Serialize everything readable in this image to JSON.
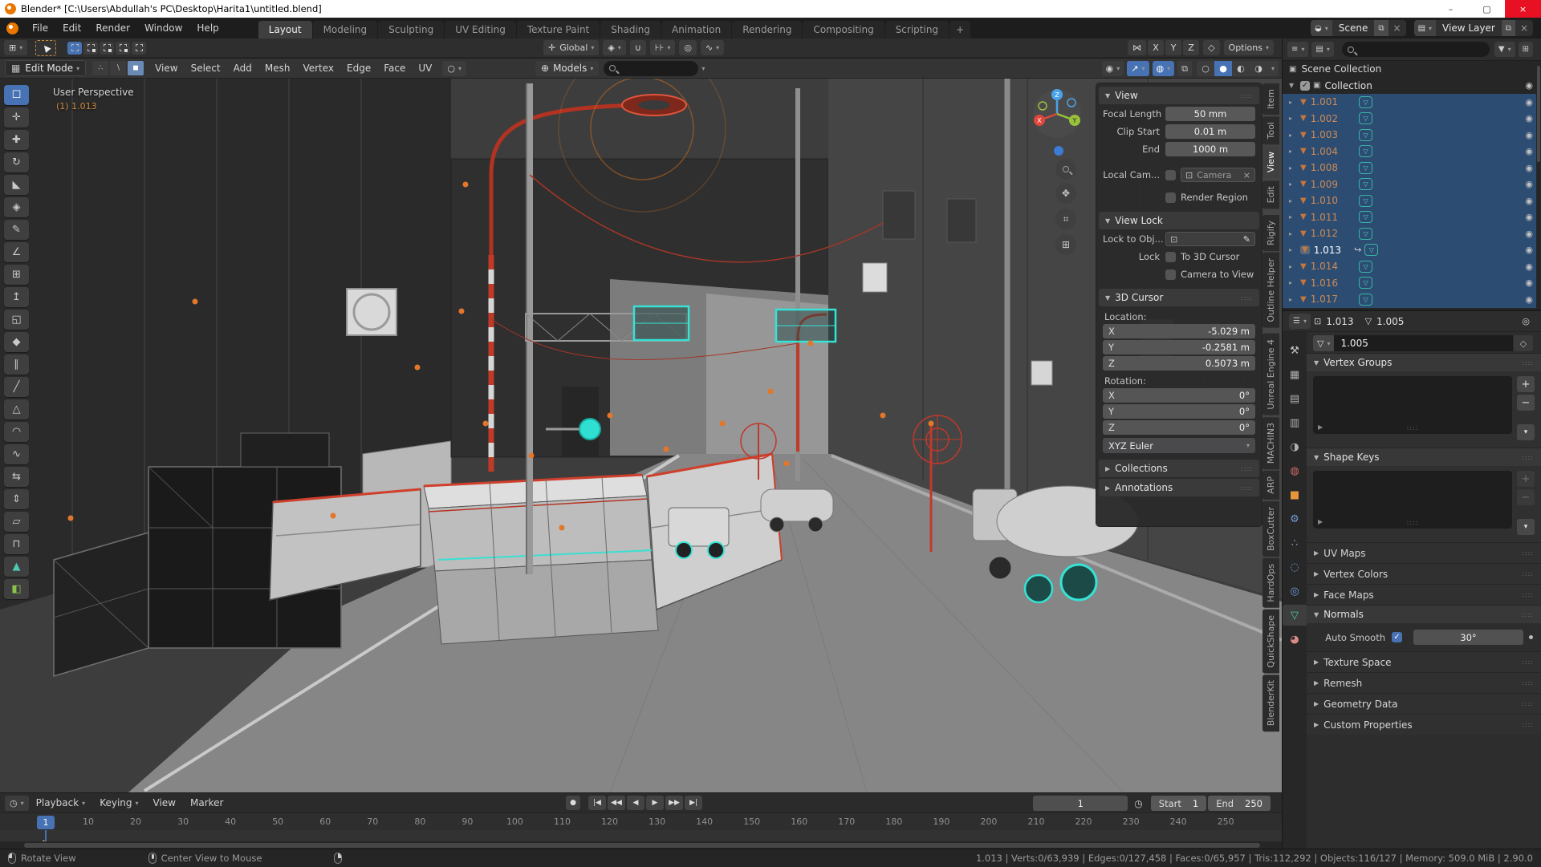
{
  "window": {
    "title": "Blender* [C:\\Users\\Abdullah's PC\\Desktop\\Harita1\\untitled.blend]",
    "minimize": "–",
    "maximize": "▢",
    "close": "×"
  },
  "topbar": {
    "menus": [
      "File",
      "Edit",
      "Render",
      "Window",
      "Help"
    ],
    "tabs": [
      "Layout",
      "Modeling",
      "Sculpting",
      "UV Editing",
      "Texture Paint",
      "Shading",
      "Animation",
      "Rendering",
      "Compositing",
      "Scripting"
    ],
    "active_tab": "Layout",
    "new_tab_label": "+",
    "scene": {
      "label": "Scene"
    },
    "view_layer": {
      "label": "View Layer"
    }
  },
  "tool_settings": {
    "orientation": "Global",
    "options_label": "Options",
    "axes": [
      "X",
      "Y",
      "Z"
    ]
  },
  "viewport": {
    "header": {
      "mode": "Edit Mode",
      "menus": [
        "View",
        "Select",
        "Add",
        "Mesh",
        "Vertex",
        "Edge",
        "Face",
        "UV"
      ]
    },
    "blenderkit": {
      "label": "Models"
    },
    "overlay": {
      "view_label": "User Perspective",
      "active_object": "(1) 1.013"
    },
    "tools": [
      {
        "name": "select-box",
        "glyph": "☐",
        "active": true
      },
      {
        "name": "cursor",
        "glyph": "✛"
      },
      {
        "name": "move",
        "glyph": "✚"
      },
      {
        "name": "rotate",
        "glyph": "↻"
      },
      {
        "name": "scale",
        "glyph": "◣"
      },
      {
        "name": "transform",
        "glyph": "◈"
      },
      {
        "name": "annotate",
        "glyph": "✎"
      },
      {
        "name": "measure",
        "glyph": "∠"
      },
      {
        "name": "add-cube",
        "glyph": "⊞"
      },
      {
        "name": "extrude-region",
        "glyph": "↥"
      },
      {
        "name": "inset-faces",
        "glyph": "◱"
      },
      {
        "name": "bevel",
        "glyph": "◆"
      },
      {
        "name": "loop-cut",
        "glyph": "∥"
      },
      {
        "name": "knife",
        "glyph": "╱"
      },
      {
        "name": "poly-build",
        "glyph": "△"
      },
      {
        "name": "spin",
        "glyph": "◠"
      },
      {
        "name": "smooth",
        "glyph": "∿"
      },
      {
        "name": "edge-slide",
        "glyph": "⇆"
      },
      {
        "name": "shrink-fatten",
        "glyph": "⇕"
      },
      {
        "name": "shear",
        "glyph": "▱"
      },
      {
        "name": "rip-region",
        "glyph": "⊓"
      },
      {
        "name": "quickshape",
        "glyph": "▲",
        "color": "#4ec9b0"
      },
      {
        "name": "boxcutter",
        "glyph": "◧",
        "color": "#8bc34a"
      }
    ],
    "side_tabs": [
      {
        "label": "Item"
      },
      {
        "label": "Tool"
      },
      {
        "label": "View",
        "active": true
      },
      {
        "label": "Edit",
        "gap_after": true
      },
      {
        "label": "Rigify"
      },
      {
        "label": "Outline Helper",
        "gap_after": true
      },
      {
        "label": "Unreal Engine 4"
      },
      {
        "label": "MACHIN3"
      },
      {
        "label": "ARP"
      },
      {
        "label": "BoxCutter"
      },
      {
        "label": "HardOps"
      },
      {
        "label": "QuickShape"
      },
      {
        "label": "BlenderKit"
      }
    ]
  },
  "n_panel": {
    "view": {
      "title": "View",
      "focal_label": "Focal Length",
      "focal_value": "50 mm",
      "clip_label": "Clip Start",
      "clip_value": "0.01 m",
      "end_label": "End",
      "end_value": "1000 m",
      "local_cam_label": "Local Cam...",
      "camera_value": "Camera",
      "render_region_label": "Render Region"
    },
    "view_lock": {
      "title": "View Lock",
      "lock_to_label": "Lock to Obj...",
      "lock_label": "Lock",
      "to_3d_cursor_label": "To 3D Cursor",
      "camera_to_view_label": "Camera to View"
    },
    "cursor": {
      "title": "3D Cursor",
      "location_label": "Location:",
      "location_rows": [
        {
          "axis": "X",
          "value": "-5.029 m"
        },
        {
          "axis": "Y",
          "value": "-0.2581 m"
        },
        {
          "axis": "Z",
          "value": "0.5073 m"
        }
      ],
      "rotation_label": "Rotation:",
      "rotation_rows": [
        {
          "axis": "X",
          "value": "0°"
        },
        {
          "axis": "Y",
          "value": "0°"
        },
        {
          "axis": "Z",
          "value": "0°"
        }
      ],
      "euler_mode": "XYZ Euler"
    },
    "collections_label": "Collections",
    "annotations_label": "Annotations"
  },
  "outliner": {
    "scene_collection_label": "Scene Collection",
    "collection_label": "Collection",
    "objects": [
      {
        "name": "1.001"
      },
      {
        "name": "1.002"
      },
      {
        "name": "1.003"
      },
      {
        "name": "1.004"
      },
      {
        "name": "1.008"
      },
      {
        "name": "1.009"
      },
      {
        "name": "1.010"
      },
      {
        "name": "1.011"
      },
      {
        "name": "1.012"
      },
      {
        "name": "1.013",
        "active": true,
        "has_modifier": true
      },
      {
        "name": "1.014"
      },
      {
        "name": "1.016"
      },
      {
        "name": "1.017"
      }
    ]
  },
  "properties": {
    "breadcrumb": {
      "object": "1.013",
      "data": "1.005"
    },
    "datablock_name": "1.005",
    "tabs": [
      {
        "name": "tool",
        "glyph": "⚒",
        "color": "#c2c2c2"
      },
      {
        "name": "render",
        "glyph": "▦",
        "color": "#b0b0b0"
      },
      {
        "name": "output",
        "glyph": "▤",
        "color": "#b0b0b0"
      },
      {
        "name": "view-layer",
        "glyph": "▥",
        "color": "#b0b0b0"
      },
      {
        "name": "scene",
        "glyph": "◑",
        "color": "#b0b0b0"
      },
      {
        "name": "world",
        "glyph": "◍",
        "color": "#d26a6a"
      },
      {
        "name": "object",
        "glyph": "■",
        "color": "#e8963c"
      },
      {
        "name": "modifiers",
        "glyph": "⚙",
        "color": "#6f9fd8"
      },
      {
        "name": "particles",
        "glyph": "∴",
        "color": "#6f9fd8"
      },
      {
        "name": "physics",
        "glyph": "◌",
        "color": "#6f9fd8"
      },
      {
        "name": "constraints",
        "glyph": "◎",
        "color": "#6f9fd8"
      },
      {
        "name": "object-data",
        "glyph": "▽",
        "color": "#4ec9a8",
        "active": true
      },
      {
        "name": "material",
        "glyph": "◕",
        "color": "#d98a8a"
      }
    ],
    "vertex_groups_label": "Vertex Groups",
    "shape_keys_label": "Shape Keys",
    "collapsed_a": [
      "UV Maps",
      "Vertex Colors",
      "Face Maps"
    ],
    "normals": {
      "label": "Normals",
      "auto_smooth_label": "Auto Smooth",
      "angle_value": "30°"
    },
    "collapsed_b": [
      "Texture Space",
      "Remesh",
      "Geometry Data",
      "Custom Properties"
    ]
  },
  "timeline": {
    "menus": {
      "playback": "Playback",
      "keying": "Keying",
      "view": "View",
      "marker": "Marker"
    },
    "transport": [
      {
        "name": "jump-to-start",
        "glyph": "|◀"
      },
      {
        "name": "prev-keyframe",
        "glyph": "◀◀"
      },
      {
        "name": "play-reverse",
        "glyph": "◀"
      },
      {
        "name": "play",
        "glyph": "▶"
      },
      {
        "name": "next-keyframe",
        "glyph": "▶▶"
      },
      {
        "name": "jump-to-end",
        "glyph": "▶|"
      }
    ],
    "current_frame": "1",
    "frame_badge": "1",
    "start_label": "Start",
    "start_value": "1",
    "end_label": "End",
    "end_value": "250",
    "ticks": [
      10,
      20,
      30,
      40,
      50,
      60,
      70,
      80,
      90,
      100,
      110,
      120,
      130,
      140,
      150,
      160,
      170,
      180,
      190,
      200,
      210,
      220,
      230,
      240,
      250
    ]
  },
  "status_bar": {
    "hints": [
      {
        "mouse": "left",
        "label": "Rotate View"
      },
      {
        "mouse": "middle",
        "label": "Center View to Mouse"
      },
      {
        "mouse": "right",
        "label": ""
      }
    ],
    "stats": "1.013 | Verts:0/63,939 | Edges:0/127,458 | Faces:0/65,957 | Tris:112,292 | Objects:116/127 | Memory: 509.0 MiB | 2.90.0"
  }
}
